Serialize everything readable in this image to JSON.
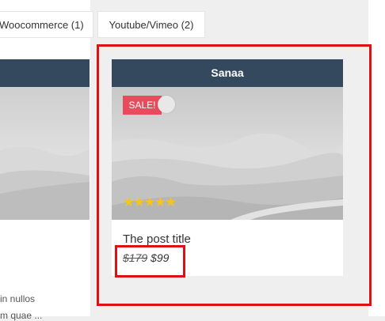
{
  "filters": [
    {
      "label": "Woocommerce (1)"
    },
    {
      "label": "Youtube/Vimeo (2)"
    }
  ],
  "left_card": {
    "excerpt_line1": "in nullos",
    "excerpt_line2": "m quae ..."
  },
  "card": {
    "author": "Sanaa",
    "sale_label": "SALE!",
    "rating_stars": "★★★★★",
    "rating": 4.5,
    "title": "The post title",
    "price_old": "$179",
    "price_new": "$99"
  },
  "colors": {
    "header_bg": "#34495e",
    "sale_bg": "#e84c5c",
    "star": "#f5c518",
    "highlight": "#dd1111"
  }
}
